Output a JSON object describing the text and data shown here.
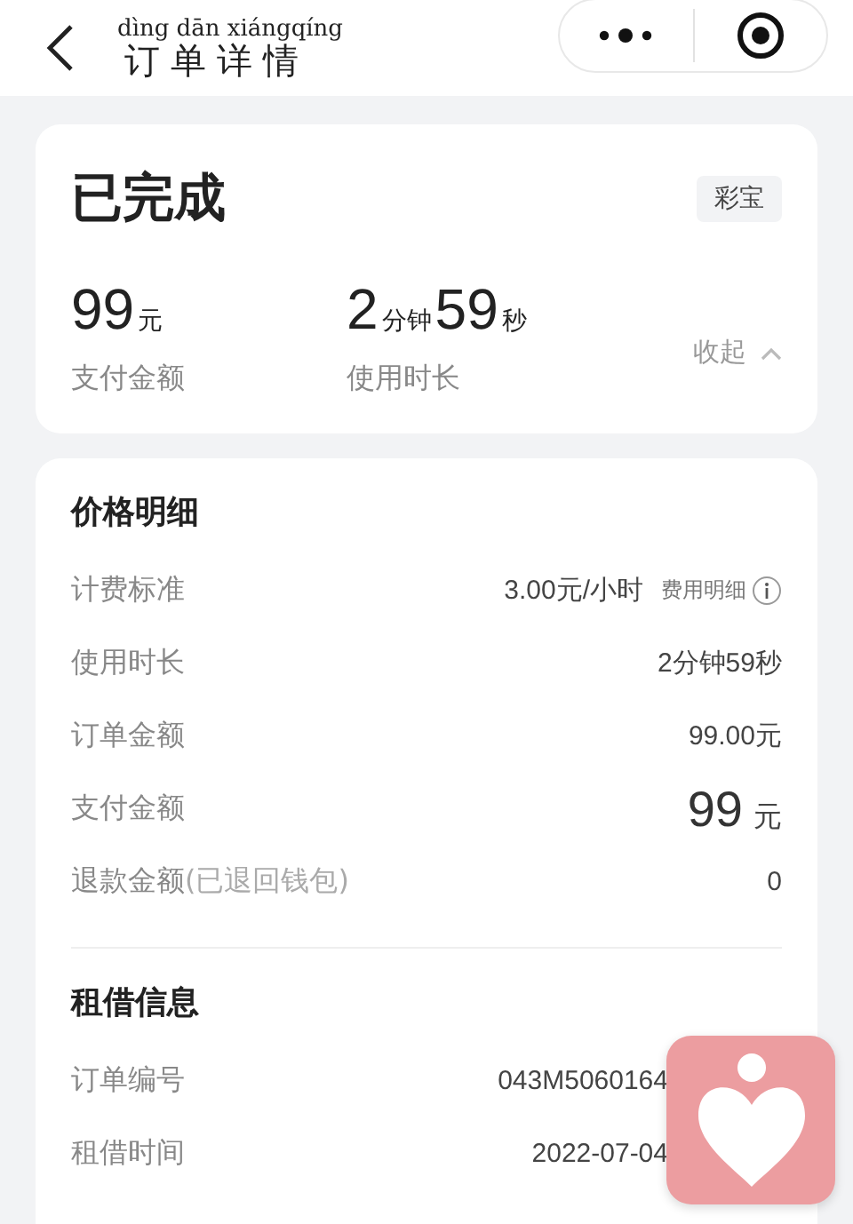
{
  "header": {
    "title": "订单详情",
    "pinyin": "dìng dān xiángqíng"
  },
  "summary": {
    "status": "已完成",
    "tag": "彩宝",
    "amount": "99",
    "amount_unit": "元",
    "amount_label": "支付金额",
    "duration": [
      {
        "text": "2",
        "kind": "number"
      },
      {
        "text": "分钟",
        "kind": "unit"
      },
      {
        "text": "59",
        "kind": "number"
      },
      {
        "text": "秒",
        "kind": "unit"
      }
    ],
    "duration_label": "使用时长",
    "toggle": "收起",
    "expanded": true
  },
  "price_detail": {
    "title": "价格明细",
    "rows": [
      {
        "label": "计费标准",
        "value": "3.00元/小时",
        "link": "费用明细",
        "kind": "plain"
      },
      {
        "label": "使用时长",
        "value": "2分钟59秒",
        "kind": "plain"
      },
      {
        "label": "订单金额",
        "value": "99.00元",
        "kind": "plain"
      },
      {
        "label": "支付金额",
        "value": "99",
        "unit": "元",
        "kind": "big"
      },
      {
        "label": "退款金额",
        "note": "(已退回钱包)",
        "value": "0",
        "kind": "plain"
      }
    ]
  },
  "rental_info": {
    "title": "租借信息",
    "rows": [
      {
        "label": "订单编号",
        "value": "043M5060164"
      },
      {
        "label": "租借时间",
        "value": "2022-07-04"
      }
    ]
  }
}
